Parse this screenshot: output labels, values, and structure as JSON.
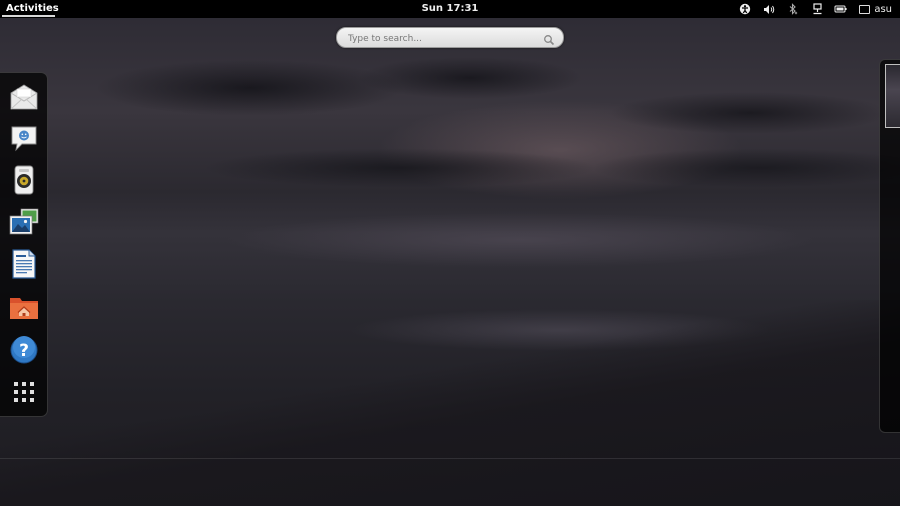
{
  "topbar": {
    "activities_label": "Activities",
    "clock": "Sun 17:31",
    "user_name": "asu",
    "status_icons": [
      "accessibility-icon",
      "volume-icon",
      "bluetooth-icon",
      "network-icon",
      "battery-icon"
    ]
  },
  "search": {
    "placeholder": "Type to search..."
  },
  "dash": {
    "apps": [
      {
        "name": "mail-app-icon"
      },
      {
        "name": "chat-app-icon"
      },
      {
        "name": "music-player-app-icon"
      },
      {
        "name": "photos-app-icon"
      },
      {
        "name": "writer-document-app-icon"
      },
      {
        "name": "files-home-app-icon"
      },
      {
        "name": "help-app-icon"
      },
      {
        "name": "show-applications-icon"
      }
    ]
  },
  "colors": {
    "panel": "#000000",
    "help_blue": "#2f78c4",
    "folder_orange": "#e2653a"
  }
}
